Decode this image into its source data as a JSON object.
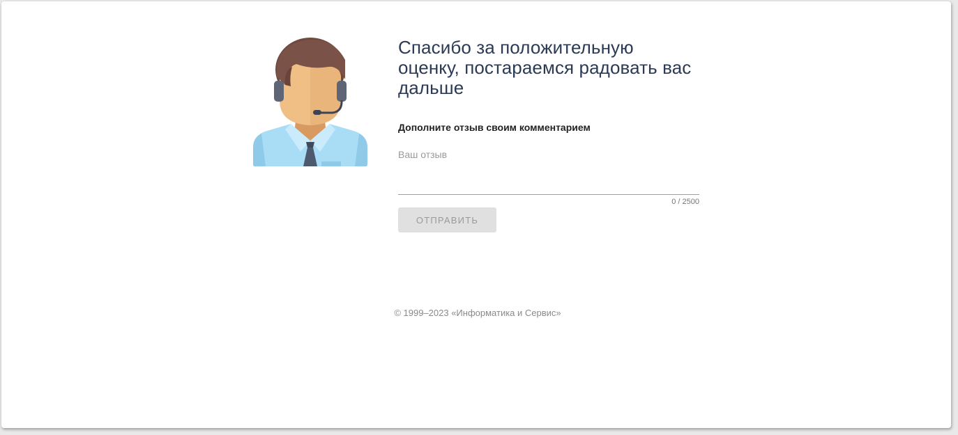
{
  "page": {
    "title": "Спасибо за положительную оценку, постараемся радовать вас дальше",
    "subtitle": "Дополните отзыв своим комментарием",
    "review_field": {
      "label": "Ваш отзыв",
      "value": "",
      "counter": "0 / 2500"
    },
    "submit_label": "ОТПРАВИТЬ",
    "footer": "© 1999–2023 «Информатика и Сервис»"
  },
  "colors": {
    "title": "#2b3a55",
    "button_bg": "#e0e0e0",
    "button_text": "#9a9a9a"
  },
  "icons": {
    "avatar": "support-operator-avatar-icon"
  }
}
